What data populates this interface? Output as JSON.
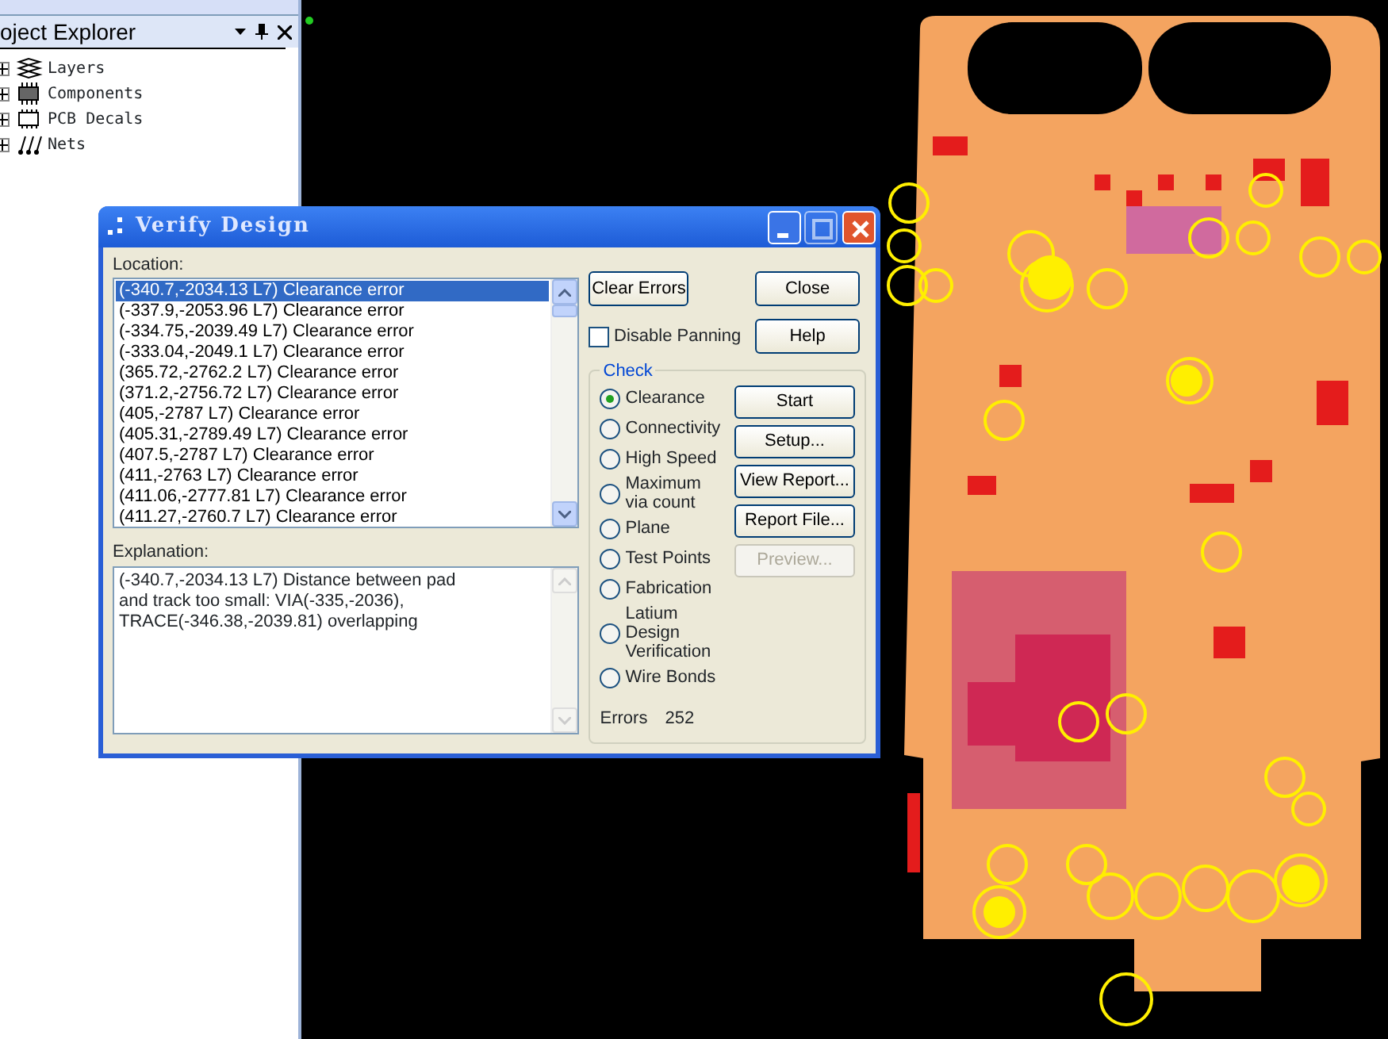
{
  "explorer": {
    "title": "oject Explorer",
    "items": [
      {
        "label": "Layers",
        "expanded": false
      },
      {
        "label": "Components",
        "expanded": false
      },
      {
        "label": "PCB Decals",
        "expanded": false
      },
      {
        "label": "Nets",
        "expanded": false
      }
    ]
  },
  "dialog": {
    "title": "Verify Design",
    "location_label": "Location:",
    "locations": [
      {
        "text": "(-340.7,-2034.13 L7) Clearance error",
        "selected": true
      },
      {
        "text": "(-337.9,-2053.96 L7) Clearance error",
        "selected": false
      },
      {
        "text": "(-334.75,-2039.49 L7) Clearance error",
        "selected": false
      },
      {
        "text": "(-333.04,-2049.1 L7) Clearance error",
        "selected": false
      },
      {
        "text": "(365.72,-2762.2 L7) Clearance error",
        "selected": false
      },
      {
        "text": "(371.2,-2756.72 L7) Clearance error",
        "selected": false
      },
      {
        "text": "(405,-2787 L7) Clearance error",
        "selected": false
      },
      {
        "text": "(405.31,-2789.49 L7) Clearance error",
        "selected": false
      },
      {
        "text": "(407.5,-2787 L7) Clearance error",
        "selected": false
      },
      {
        "text": "(411,-2763 L7) Clearance error",
        "selected": false
      },
      {
        "text": "(411.06,-2777.81 L7) Clearance error",
        "selected": false
      },
      {
        "text": "(411.27,-2760.7 L7) Clearance error",
        "selected": false
      }
    ],
    "explanation_label": "Explanation:",
    "explanation": "(-340.7,-2034.13 L7) Distance between pad and track too small: VIA(-335,-2036), TRACE(-346.38,-2039.81) overlapping",
    "clear_button": "Clear Errors",
    "close_button": "Close",
    "help_button": "Help",
    "disable_panning": {
      "label": "Disable Panning",
      "checked": false
    },
    "check_label": "Check",
    "checks": [
      {
        "label": "Clearance",
        "selected": true
      },
      {
        "label": "Connectivity",
        "selected": false
      },
      {
        "label": "High Speed",
        "selected": false
      },
      {
        "label": "Maximum via count",
        "selected": false
      },
      {
        "label": "Plane",
        "selected": false
      },
      {
        "label": "Test Points",
        "selected": false
      },
      {
        "label": "Fabrication",
        "selected": false
      },
      {
        "label": "Latium Design Verification",
        "selected": false
      },
      {
        "label": "Wire Bonds",
        "selected": false
      }
    ],
    "actions": [
      {
        "label": "Start",
        "disabled": false
      },
      {
        "label": "Setup...",
        "disabled": false
      },
      {
        "label": "View Report...",
        "disabled": false
      },
      {
        "label": "Report File...",
        "disabled": false
      },
      {
        "label": "Preview...",
        "disabled": true
      }
    ],
    "errors_label": "Errors",
    "errors_count": "252"
  }
}
